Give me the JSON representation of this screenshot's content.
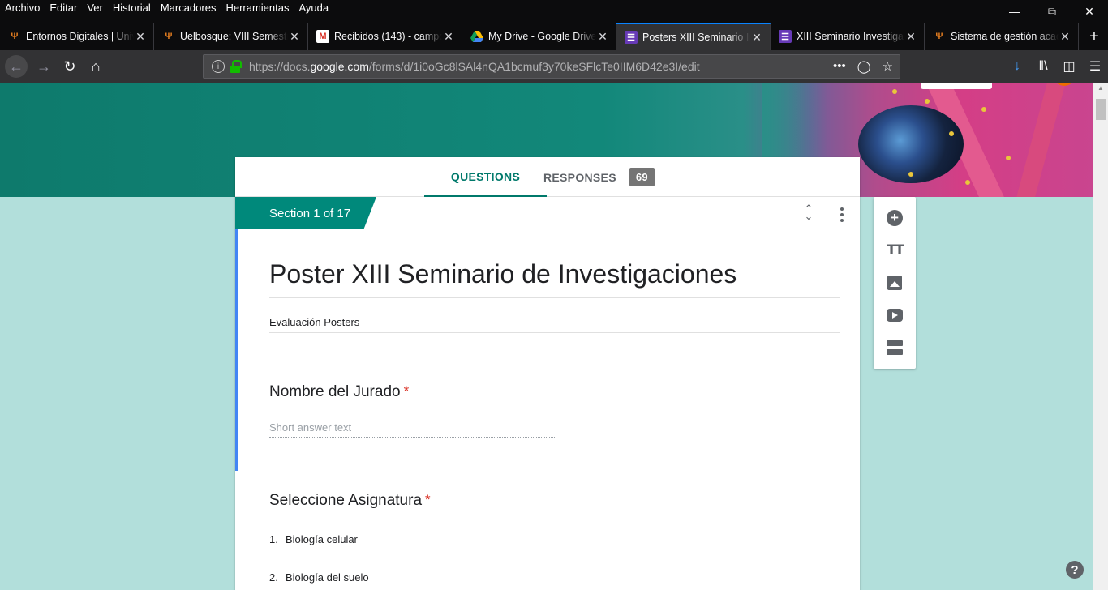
{
  "menubar": {
    "items": [
      "Archivo",
      "Editar",
      "Ver",
      "Historial",
      "Marcadores",
      "Herramientas",
      "Ayuda"
    ]
  },
  "tabs": [
    {
      "title": "Entornos Digitales | Unive",
      "icon": "uelbosque-icon",
      "active": false
    },
    {
      "title": "Uelbosque: VIII Semestre",
      "icon": "uelbosque-icon",
      "active": false
    },
    {
      "title": "Recibidos (143) - campos",
      "icon": "gmail-icon",
      "active": false
    },
    {
      "title": "My Drive - Google Drive",
      "icon": "drive-icon",
      "active": false
    },
    {
      "title": "Posters XIII Seminario Inv",
      "icon": "forms-icon",
      "active": true
    },
    {
      "title": "XIII Seminario Investigac",
      "icon": "forms-icon",
      "active": false
    },
    {
      "title": "Sistema de gestión acade",
      "icon": "uelbosque-icon",
      "active": false
    }
  ],
  "address": {
    "prefix": "https://docs.",
    "domain": "google.com",
    "path": "/forms/d/1i0oGc8lSAl4nQA1bcmuf3y70keSFlcTe0IIM6D42e3I/edit"
  },
  "form": {
    "tab_questions": "QUESTIONS",
    "tab_responses": "RESPONSES",
    "responses_count": "69",
    "section_label": "Section 1 of 17",
    "title": "Poster XIII Seminario de Investigaciones",
    "description": "Evaluación Posters",
    "q1": {
      "title": "Nombre del Jurado",
      "required_mark": "*",
      "placeholder": "Short answer text"
    },
    "q2": {
      "title": "Seleccione Asignatura",
      "required_mark": "*",
      "options": [
        {
          "num": "1.",
          "label": "Biología celular"
        },
        {
          "num": "2.",
          "label": "Biología del suelo"
        }
      ]
    }
  },
  "colors": {
    "accent": "#00796b",
    "section_bg": "#00897b",
    "page_bg": "#b2dfdb",
    "focus": "#4285f4"
  }
}
